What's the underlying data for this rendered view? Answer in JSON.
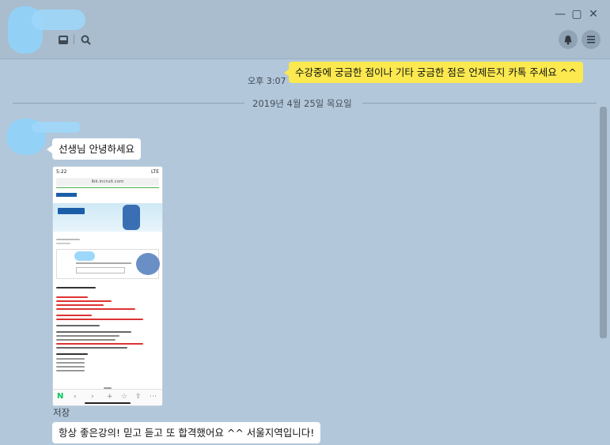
{
  "window": {
    "minimize_glyph": "—",
    "maximize_glyph": "▢",
    "close_glyph": "✕"
  },
  "icons": {
    "inbox": "inbox-icon",
    "search": "search-icon",
    "bell": "bell-icon",
    "menu": "menu-icon"
  },
  "messages": {
    "outgoing_1": {
      "time": "오후 3:07",
      "text": "수강중에 궁금한 점이나 기타 궁금한 점은 언제든지 카톡 주세요 ^^"
    },
    "date_divider": "2019년 4월 25일 목요일",
    "incoming_1": {
      "text": "선생님 안녕하세요"
    },
    "screenshot": {
      "status_time": "5:22",
      "status_right": "LTE",
      "url": "lbk.incruit.com"
    },
    "save_label": "저장",
    "incoming_2": {
      "text": "항상 좋은강의! 믿고 듣고 또 합격했어요 ^^ 서울지역입니다!"
    }
  },
  "colors": {
    "my_bubble": "#fbe94f",
    "other_bubble": "#ffffff",
    "background": "#b2c7da"
  }
}
